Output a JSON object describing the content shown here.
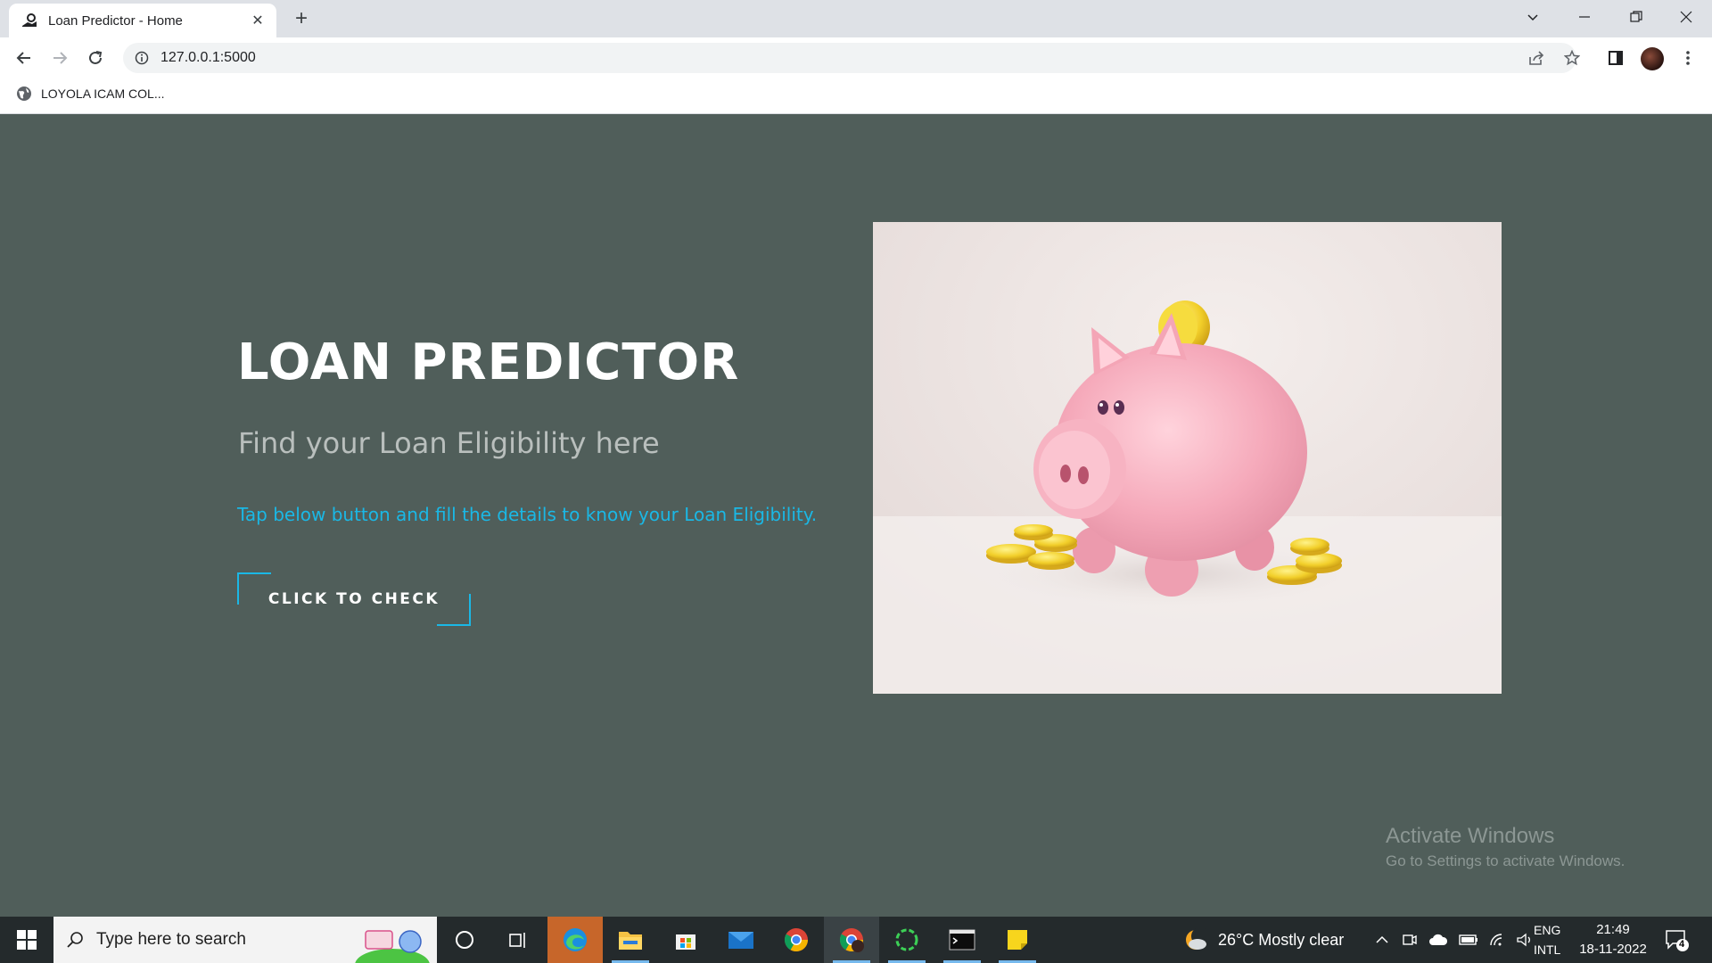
{
  "browser": {
    "tab_title": "Loan Predictor - Home",
    "url": "127.0.0.1:5000",
    "bookmark_label": "LOYOLA ICAM COL..."
  },
  "hero": {
    "title": "LOAN PREDICTOR",
    "subtitle": "Find your Loan Eligibility here",
    "tip": "Tap below button and fill the details to know your Loan Eligibility.",
    "cta_label": "CLICK TO CHECK",
    "image_subject": "pink piggy bank with gold coins"
  },
  "watermark": {
    "line1": "Activate Windows",
    "line2": "Go to Settings to activate Windows."
  },
  "taskbar": {
    "search_placeholder": "Type here to search",
    "weather": "26°C  Mostly clear",
    "lang_top": "ENG",
    "lang_bottom": "INTL",
    "time": "21:49",
    "date": "18-11-2022",
    "notification_count": "4",
    "apps": [
      "task-view",
      "edge",
      "file-explorer",
      "microsoft-store",
      "mail",
      "chrome",
      "chrome-profile",
      "spinner-app",
      "terminal",
      "sticky-notes"
    ]
  },
  "colors": {
    "page_bg": "#505e5a",
    "accent": "#1ab8e6",
    "title": "#ffffff",
    "subtitle": "#b9bfbd"
  }
}
